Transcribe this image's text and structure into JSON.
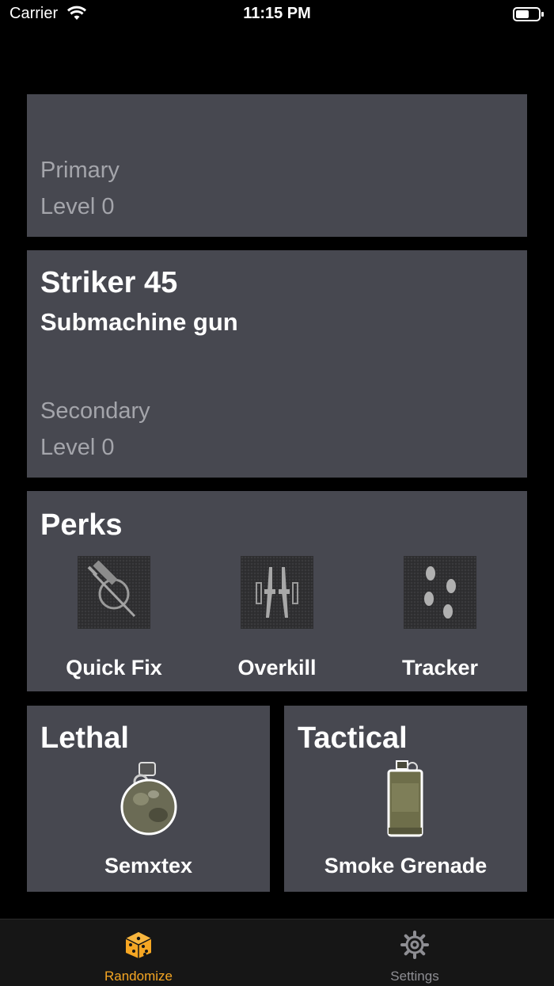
{
  "status_bar": {
    "carrier": "Carrier",
    "time": "11:15 PM"
  },
  "primary_card": {
    "type": "Primary",
    "level": "Level 0"
  },
  "secondary_card": {
    "name": "Striker 45",
    "category": "Submachine gun",
    "type": "Secondary",
    "level": "Level 0"
  },
  "perks_card": {
    "title": "Perks",
    "items": [
      {
        "label": "Quick Fix",
        "icon": "syringe-icon"
      },
      {
        "label": "Overkill",
        "icon": "twin-rifles-icon"
      },
      {
        "label": "Tracker",
        "icon": "footprints-icon"
      }
    ]
  },
  "lethal_card": {
    "title": "Lethal",
    "item": "Semxtex",
    "icon": "semtex-grenade-icon"
  },
  "tactical_card": {
    "title": "Tactical",
    "item": "Smoke Grenade",
    "icon": "smoke-grenade-icon"
  },
  "tabbar": {
    "tabs": [
      {
        "label": "Randomize",
        "icon": "dice-icon",
        "active": true
      },
      {
        "label": "Settings",
        "icon": "gear-icon",
        "active": false
      }
    ]
  },
  "colors": {
    "accent": "#f5a623",
    "inactive": "#8e8e93",
    "card": "#474850"
  }
}
